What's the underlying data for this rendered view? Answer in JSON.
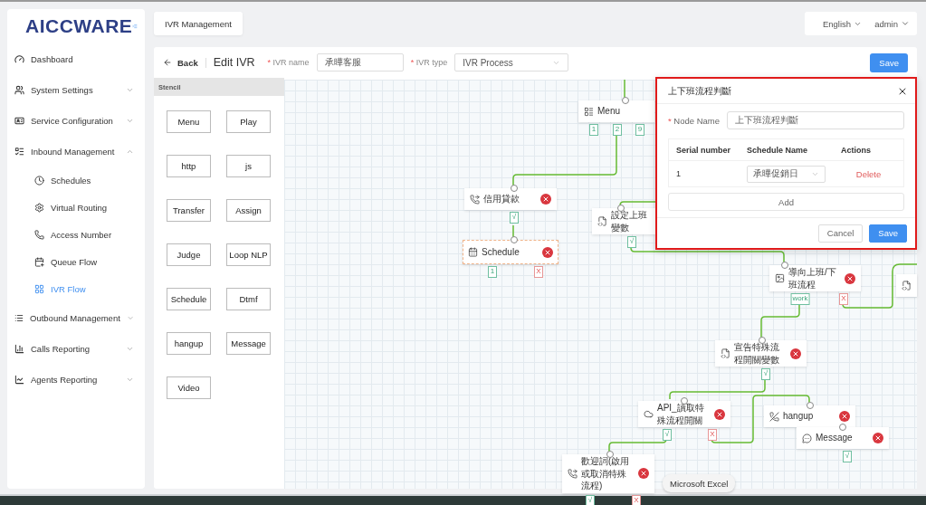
{
  "logo": "AICCWARE",
  "sidebar": {
    "items": [
      {
        "label": "Dashboard",
        "kind": "link"
      },
      {
        "label": "System Settings",
        "kind": "group",
        "expanded": false
      },
      {
        "label": "Service Configuration",
        "kind": "group",
        "expanded": false
      },
      {
        "label": "Inbound Management",
        "kind": "group",
        "expanded": true,
        "children": [
          {
            "label": "Schedules",
            "selected": false
          },
          {
            "label": "Virtual Routing",
            "selected": false
          },
          {
            "label": "Access Number",
            "selected": false
          },
          {
            "label": "Queue Flow",
            "selected": false
          },
          {
            "label": "IVR Flow",
            "selected": true
          }
        ]
      },
      {
        "label": "Outbound Management",
        "kind": "group",
        "expanded": false
      },
      {
        "label": "Calls Reporting",
        "kind": "group",
        "expanded": false
      },
      {
        "label": "Agents Reporting",
        "kind": "group",
        "expanded": false
      }
    ]
  },
  "header": {
    "tabs": [
      {
        "label": "IVR Management",
        "selected": true
      }
    ],
    "language": "English",
    "user": "admin"
  },
  "toolbar": {
    "back": "Back",
    "title": "Edit IVR",
    "name_mark": "*",
    "name_label": "IVR name",
    "type_mark": "*",
    "name_value": "承曄客服",
    "type_label": "IVR type",
    "type_value": "IVR Process",
    "save": "Save"
  },
  "stencil": {
    "title": "Stencil",
    "items": [
      "Menu",
      "Play",
      "http",
      "js",
      "Transfer",
      "Assign",
      "Judge",
      "Loop NLP",
      "Schedule",
      "Dtmf",
      "hangup",
      "Message",
      "Video"
    ]
  },
  "canvas": {
    "nodes": [
      {
        "kind": "menu",
        "label": "Menu",
        "selected": false,
        "ports": [
          {
            "label": "1",
            "kind": "pass"
          },
          {
            "label": "2",
            "kind": "pass"
          },
          {
            "label": "9",
            "kind": "pass"
          }
        ]
      },
      {
        "kind": "call",
        "label": "信用貸款",
        "selected": false,
        "ports": [
          {
            "label": "√",
            "kind": "pass"
          }
        ]
      },
      {
        "kind": "schedule",
        "label": "Schedule",
        "selected": true,
        "ports": [
          {
            "label": "1",
            "kind": "pass"
          },
          {
            "label": "X",
            "kind": "fail"
          }
        ]
      },
      {
        "kind": "variable",
        "label": "設定上班變數",
        "selected": false,
        "ports": [
          {
            "label": "√",
            "kind": "pass"
          }
        ]
      },
      {
        "kind": "judge",
        "label": "導向上班/下班流程",
        "selected": false,
        "ports": [
          {
            "label": "work",
            "kind": "pass"
          },
          {
            "label": "X",
            "kind": "fail"
          }
        ]
      },
      {
        "kind": "variable",
        "selected": false
      },
      {
        "kind": "variable",
        "label": "宣告特殊流程開關變數",
        "selected": false,
        "ports": [
          {
            "label": "√",
            "kind": "pass"
          }
        ]
      },
      {
        "kind": "api",
        "label": "API_讀取特殊流程開關",
        "selected": false,
        "ports": [
          {
            "label": "√",
            "kind": "pass"
          },
          {
            "label": "X",
            "kind": "fail"
          }
        ]
      },
      {
        "kind": "hangup",
        "label": "hangup",
        "selected": false
      },
      {
        "kind": "message",
        "label": "Message",
        "selected": false,
        "ports": [
          {
            "label": "√",
            "kind": "pass"
          }
        ]
      },
      {
        "kind": "call",
        "label": "歡迎詞(啟用或取消特殊流程)",
        "selected": false,
        "ports": [
          {
            "label": "√",
            "kind": "pass"
          },
          {
            "label": "X",
            "kind": "fail"
          }
        ]
      }
    ]
  },
  "dialog": {
    "title": "上下班流程判斷",
    "node_name_mark": "*",
    "node_name_label": "Node Name",
    "node_name_value": "上下班流程判斷",
    "columns": [
      "Serial number",
      "Schedule Name",
      "Actions"
    ],
    "rows": [
      {
        "serial": "1",
        "schedule": "承曄促銷日",
        "action": "Delete"
      }
    ],
    "add": "Add",
    "cancel": "Cancel",
    "save": "Save"
  },
  "tooltip": "Microsoft Excel"
}
